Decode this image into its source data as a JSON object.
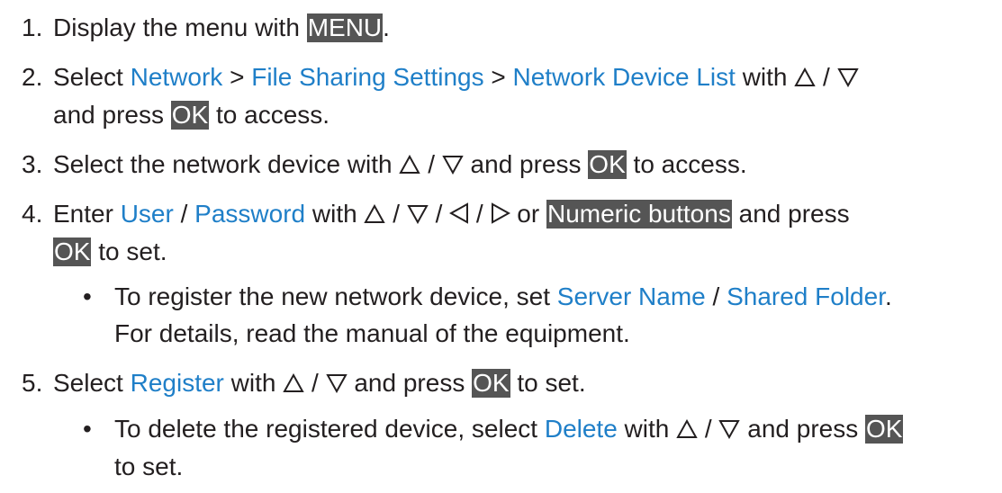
{
  "colors": {
    "text": "#231f20",
    "link": "#1f7fc8",
    "key_bg": "#555555",
    "key_text": "#ffffff"
  },
  "icons": [
    "up-triangle-icon",
    "down-triangle-icon",
    "left-triangle-icon",
    "right-triangle-icon"
  ],
  "steps": [
    {
      "num": "1.",
      "t1": "Display the menu with ",
      "k1": "MENU",
      "t2": "."
    },
    {
      "num": "2.",
      "t1": "Select ",
      "l1": "Network",
      "t2": " > ",
      "l2": "File Sharing Settings",
      "t3": " > ",
      "l3": "Network Device List",
      "t4": " with ",
      "sep": " / ",
      "t5": "and press ",
      "k1": "OK",
      "t6": " to access."
    },
    {
      "num": "3.",
      "t1": "Select the network device with ",
      "sep": " / ",
      "t2": " and press ",
      "k1": "OK",
      "t3": " to access."
    },
    {
      "num": "4.",
      "t1": "Enter ",
      "l1": "User",
      "t2": " / ",
      "l2": "Password",
      "t3": " with ",
      "sep": " / ",
      "t4": " or ",
      "k1": "Numeric buttons",
      "t5": " and press",
      "k2": "OK",
      "t6": " to set."
    },
    {
      "num": "5.",
      "t1": "Select ",
      "l1": "Register",
      "t2": " with ",
      "sep": " / ",
      "t3": " and press ",
      "k1": "OK",
      "t4": " to set."
    }
  ],
  "notes": [
    {
      "bullet": "•",
      "t1": "To register the new network device, set ",
      "l1": "Server Name",
      "t2": " / ",
      "l2": "Shared Folder",
      "t3": ".",
      "t4": "For details, read the manual of the equipment."
    },
    {
      "bullet": "•",
      "t1": "To delete the registered device, select ",
      "l1": "Delete",
      "t2": " with ",
      "sep": " / ",
      "t3": " and press ",
      "k1": "OK",
      "t4": "to set."
    }
  ]
}
